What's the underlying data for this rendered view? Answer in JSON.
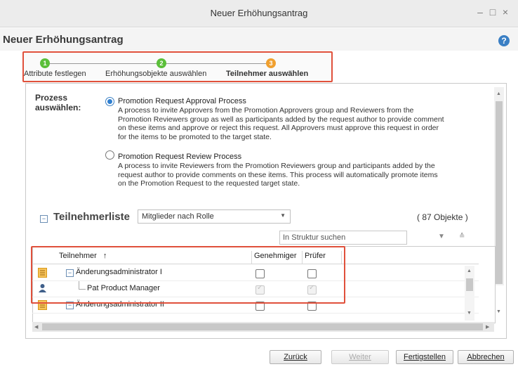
{
  "window": {
    "title": "Neuer Erhöhungsantrag",
    "minimize": "–",
    "maximize": "□",
    "close": "×"
  },
  "header": {
    "title": "Neuer Erhöhungsantrag",
    "help": "?"
  },
  "wizard": {
    "steps": [
      {
        "number": "1",
        "label": "Attribute festlegen",
        "color": "#5bbf3a"
      },
      {
        "number": "2",
        "label": "Erhöhungsobjekte auswählen",
        "color": "#5bbf3a"
      },
      {
        "number": "3",
        "label": "Teilnehmer auswählen",
        "color": "#f0a030"
      }
    ]
  },
  "process": {
    "label_line1": "Prozess",
    "label_line2": "auswählen:",
    "options": [
      {
        "title": "Promotion Request Approval Process",
        "selected": true,
        "desc": [
          "A process to invite Approvers from the Promotion Approvers group and Reviewers from the",
          "Promotion Reviewers group as well as participants added by the request author to provide comment",
          "on these items and approve or reject this request. All Approvers must approve this request in order",
          "for the items to be promoted to the target state."
        ]
      },
      {
        "title": "Promotion Request Review Process",
        "selected": false,
        "desc": [
          "A process to invite Reviewers from the Promotion Reviewers group and participants added by the",
          "request author to provide comments on these items. This process will automatically promote items",
          "on the Promotion Request to the requested target state."
        ]
      }
    ]
  },
  "participants": {
    "title": "Teilnehmerliste",
    "toggle": "−",
    "filter_value": "Mitglieder nach Rolle",
    "count": "( 87 Objekte )",
    "search_placeholder": "In Struktur suchen",
    "columns": {
      "participant": "Teilnehmer",
      "sort_indicator": "↑",
      "approver": "Genehmiger",
      "reviewer": "Prüfer"
    },
    "rows": [
      {
        "name": "Änderungsadministrator I",
        "type": "group",
        "expanded": true,
        "approver": false,
        "reviewer": false,
        "disabled": false
      },
      {
        "name": "Pat Product Manager",
        "type": "user",
        "approver": true,
        "reviewer": true,
        "disabled": true
      },
      {
        "name": "Änderungsadministrator II",
        "type": "group",
        "expanded": true,
        "approver": false,
        "reviewer": false,
        "disabled": false
      }
    ]
  },
  "buttons": {
    "back": "Zurück",
    "next": "Weiter",
    "finish": "Fertigstellen",
    "cancel": "Abbrechen"
  },
  "colors": {
    "accent": "#3a7fc4",
    "highlight": "#e0503b"
  }
}
